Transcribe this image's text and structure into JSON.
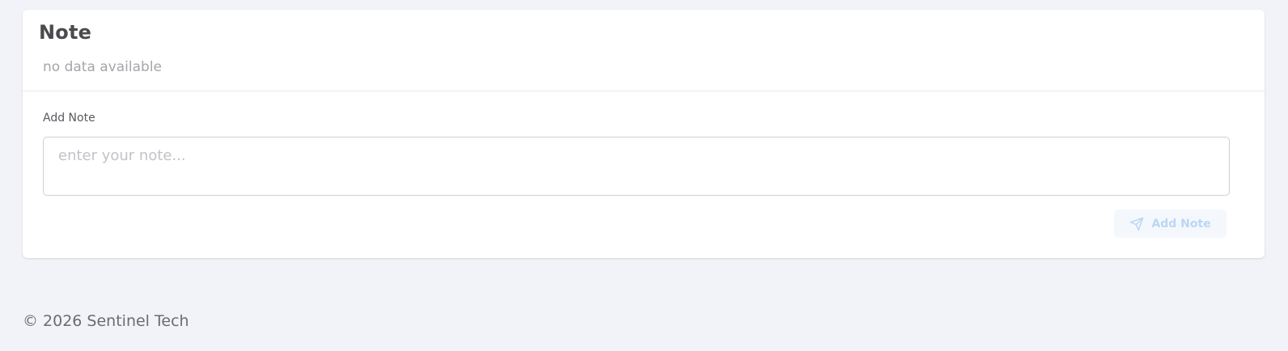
{
  "note_card": {
    "title": "Note",
    "empty_message": "no data available"
  },
  "add_note_form": {
    "label": "Add Note",
    "input_placeholder": "enter your note...",
    "input_value": "",
    "submit_label": "Add Note",
    "submit_icon": "send-icon",
    "submit_disabled": true
  },
  "footer": {
    "copyright": "© 2026 Sentinel Tech"
  },
  "colors": {
    "page_background": "#f2f3f8",
    "card_background": "#ffffff",
    "button_disabled_background": "#f4f8fd",
    "button_disabled_text": "#bcd6f3"
  }
}
